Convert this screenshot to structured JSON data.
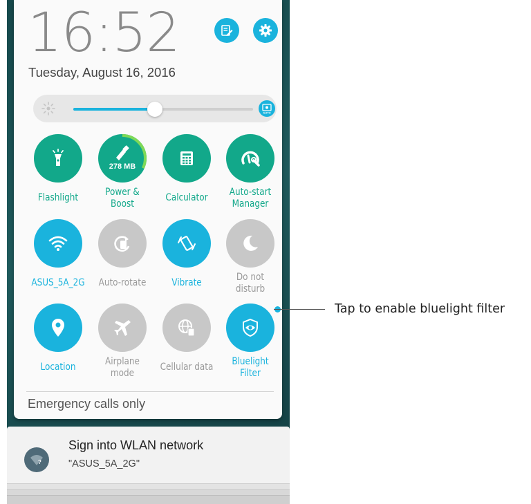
{
  "status": {
    "time": "16:52",
    "date": "Tuesday, August 16, 2016"
  },
  "header_buttons": {
    "edit_icon": "edit-icon",
    "settings_icon": "gear-icon"
  },
  "brightness": {
    "level": 0.455,
    "auto_label": "AUTO"
  },
  "tiles": [
    {
      "label": "Flashlight",
      "icon": "flashlight-icon",
      "state": "on",
      "color": "green"
    },
    {
      "label": "Power &\nBoost",
      "icon": "boost-icon",
      "state": "on",
      "color": "green",
      "badge": "278 MB",
      "ring_fraction": 0.32
    },
    {
      "label": "Calculator",
      "icon": "calculator-icon",
      "state": "on",
      "color": "green"
    },
    {
      "label": "Auto-start\nManager",
      "icon": "auto-start-icon",
      "state": "on",
      "color": "green"
    },
    {
      "label": "ASUS_5A_2G",
      "icon": "wifi-icon",
      "state": "on",
      "color": "blue"
    },
    {
      "label": "Auto-rotate",
      "icon": "rotate-icon",
      "state": "off",
      "color": "grey"
    },
    {
      "label": "Vibrate",
      "icon": "vibrate-icon",
      "state": "on",
      "color": "blue"
    },
    {
      "label": "Do not\ndisturb",
      "icon": "moon-icon",
      "state": "off",
      "color": "grey"
    },
    {
      "label": "Location",
      "icon": "location-icon",
      "state": "on",
      "color": "blue"
    },
    {
      "label": "Airplane\nmode",
      "icon": "airplane-icon",
      "state": "off",
      "color": "grey"
    },
    {
      "label": "Cellular data",
      "icon": "globe-icon",
      "state": "off",
      "color": "grey"
    },
    {
      "label": "Bluelight\nFilter",
      "icon": "eye-shield-icon",
      "state": "on",
      "color": "blue"
    }
  ],
  "footer": {
    "emergency": "Emergency calls only"
  },
  "notification": {
    "title": "Sign into WLAN network",
    "subtitle": "\"ASUS_5A_2G\"",
    "icon": "wifi-question-icon"
  },
  "callout": {
    "text": "Tap to enable bluelight filter"
  },
  "colors": {
    "accent_blue": "#1ab3dd",
    "accent_green": "#12a88a",
    "inactive_grey": "#c8c8c8"
  }
}
